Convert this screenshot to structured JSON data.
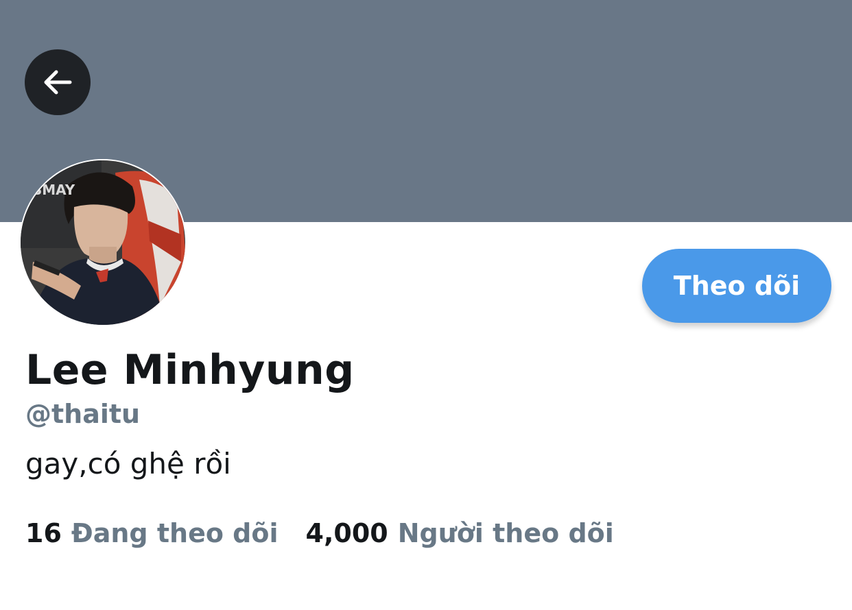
{
  "profile": {
    "display_name": "Lee Minhyung",
    "handle": "@thaitu",
    "bio": "gay,có ghệ rồi",
    "follow_label": "Theo dõi",
    "following_count": "16",
    "following_label": "Đang theo dõi",
    "followers_count": "4,000",
    "followers_label": "Người theo dõi"
  },
  "icons": {
    "back": "arrow-left-icon"
  },
  "colors": {
    "banner": "#697787",
    "accent": "#4a99e9",
    "text_primary": "#14171a",
    "text_secondary": "#687886"
  }
}
